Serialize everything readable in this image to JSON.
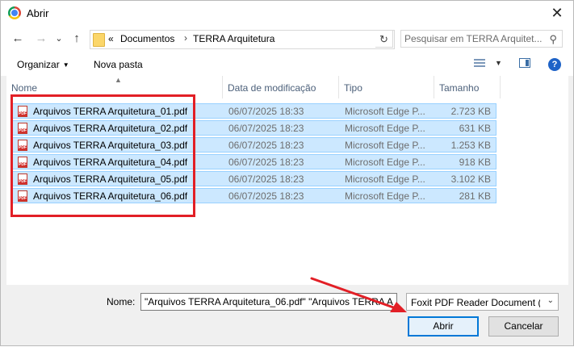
{
  "window": {
    "title": "Abrir",
    "close_symbol": "✕"
  },
  "nav": {
    "back_symbol": "←",
    "forward_symbol": "→",
    "recent_symbol": "⌄",
    "up_symbol": "↑",
    "breadcrumb_overflow": "«",
    "breadcrumbs": [
      "Documentos",
      "TERRA Arquitetura"
    ],
    "breadcrumb_separator": "›",
    "refresh_symbol": "↻",
    "search_placeholder": "Pesquisar em TERRA Arquitet..."
  },
  "toolbar": {
    "organize": "Organizar",
    "new_folder": "Nova pasta",
    "help_symbol": "?"
  },
  "columns": {
    "name": "Nome",
    "date": "Data de modificação",
    "type": "Tipo",
    "size": "Tamanho"
  },
  "files": [
    {
      "name": "Arquivos TERRA Arquitetura_01.pdf",
      "date": "06/07/2025 18:33",
      "type": "Microsoft Edge P...",
      "size": "2.723 KB"
    },
    {
      "name": "Arquivos TERRA Arquitetura_02.pdf",
      "date": "06/07/2025 18:23",
      "type": "Microsoft Edge P...",
      "size": "631 KB"
    },
    {
      "name": "Arquivos TERRA Arquitetura_03.pdf",
      "date": "06/07/2025 18:23",
      "type": "Microsoft Edge P...",
      "size": "1.253 KB"
    },
    {
      "name": "Arquivos TERRA Arquitetura_04.pdf",
      "date": "06/07/2025 18:23",
      "type": "Microsoft Edge P...",
      "size": "918 KB"
    },
    {
      "name": "Arquivos TERRA Arquitetura_05.pdf",
      "date": "06/07/2025 18:23",
      "type": "Microsoft Edge P...",
      "size": "3.102 KB"
    },
    {
      "name": "Arquivos TERRA Arquitetura_06.pdf",
      "date": "06/07/2025 18:23",
      "type": "Microsoft Edge P...",
      "size": "281 KB"
    }
  ],
  "footer": {
    "name_label": "Nome:",
    "name_value": "\"Arquivos TERRA Arquitetura_06.pdf\" \"Arquivos TERRA A",
    "filter_value": "Foxit PDF Reader Document (*.",
    "open_label": "Abrir",
    "cancel_label": "Cancelar"
  },
  "colors": {
    "selection": "#cce8ff",
    "annotation": "#e21f26",
    "accent": "#0078d7"
  }
}
